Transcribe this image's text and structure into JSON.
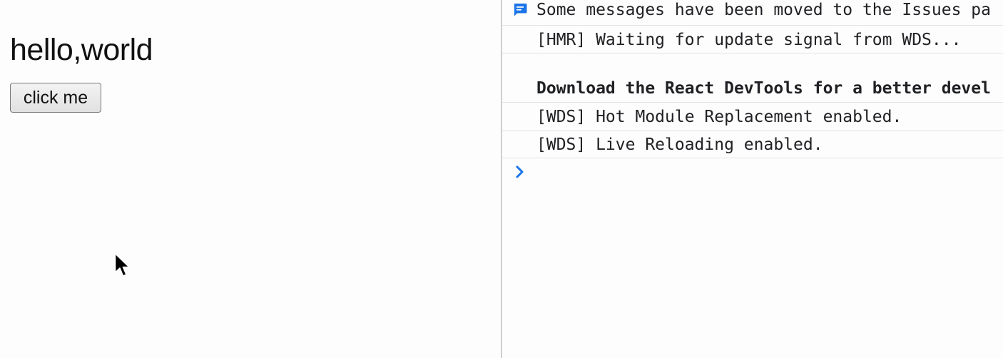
{
  "app": {
    "heading": "hello,world",
    "button_label": "click me"
  },
  "console": {
    "messages": [
      {
        "text": "Some messages have been moved to the Issues pa",
        "icon": "issues-message-icon",
        "type": "info"
      },
      {
        "text": "[HMR] Waiting for update signal from WDS...",
        "type": "log"
      },
      {
        "text": "Download the React DevTools for a better devel",
        "type": "log-bold"
      },
      {
        "text": "[WDS] Hot Module Replacement enabled.",
        "type": "log"
      },
      {
        "text": "[WDS] Live Reloading enabled.",
        "type": "log"
      }
    ],
    "prompt_icon": "chevron-right-icon"
  },
  "colors": {
    "accent_blue": "#1a73e8",
    "background": "#fdfdfd",
    "divider": "#cfcfcf",
    "row_border": "#e3e3e3",
    "text": "#202124"
  }
}
